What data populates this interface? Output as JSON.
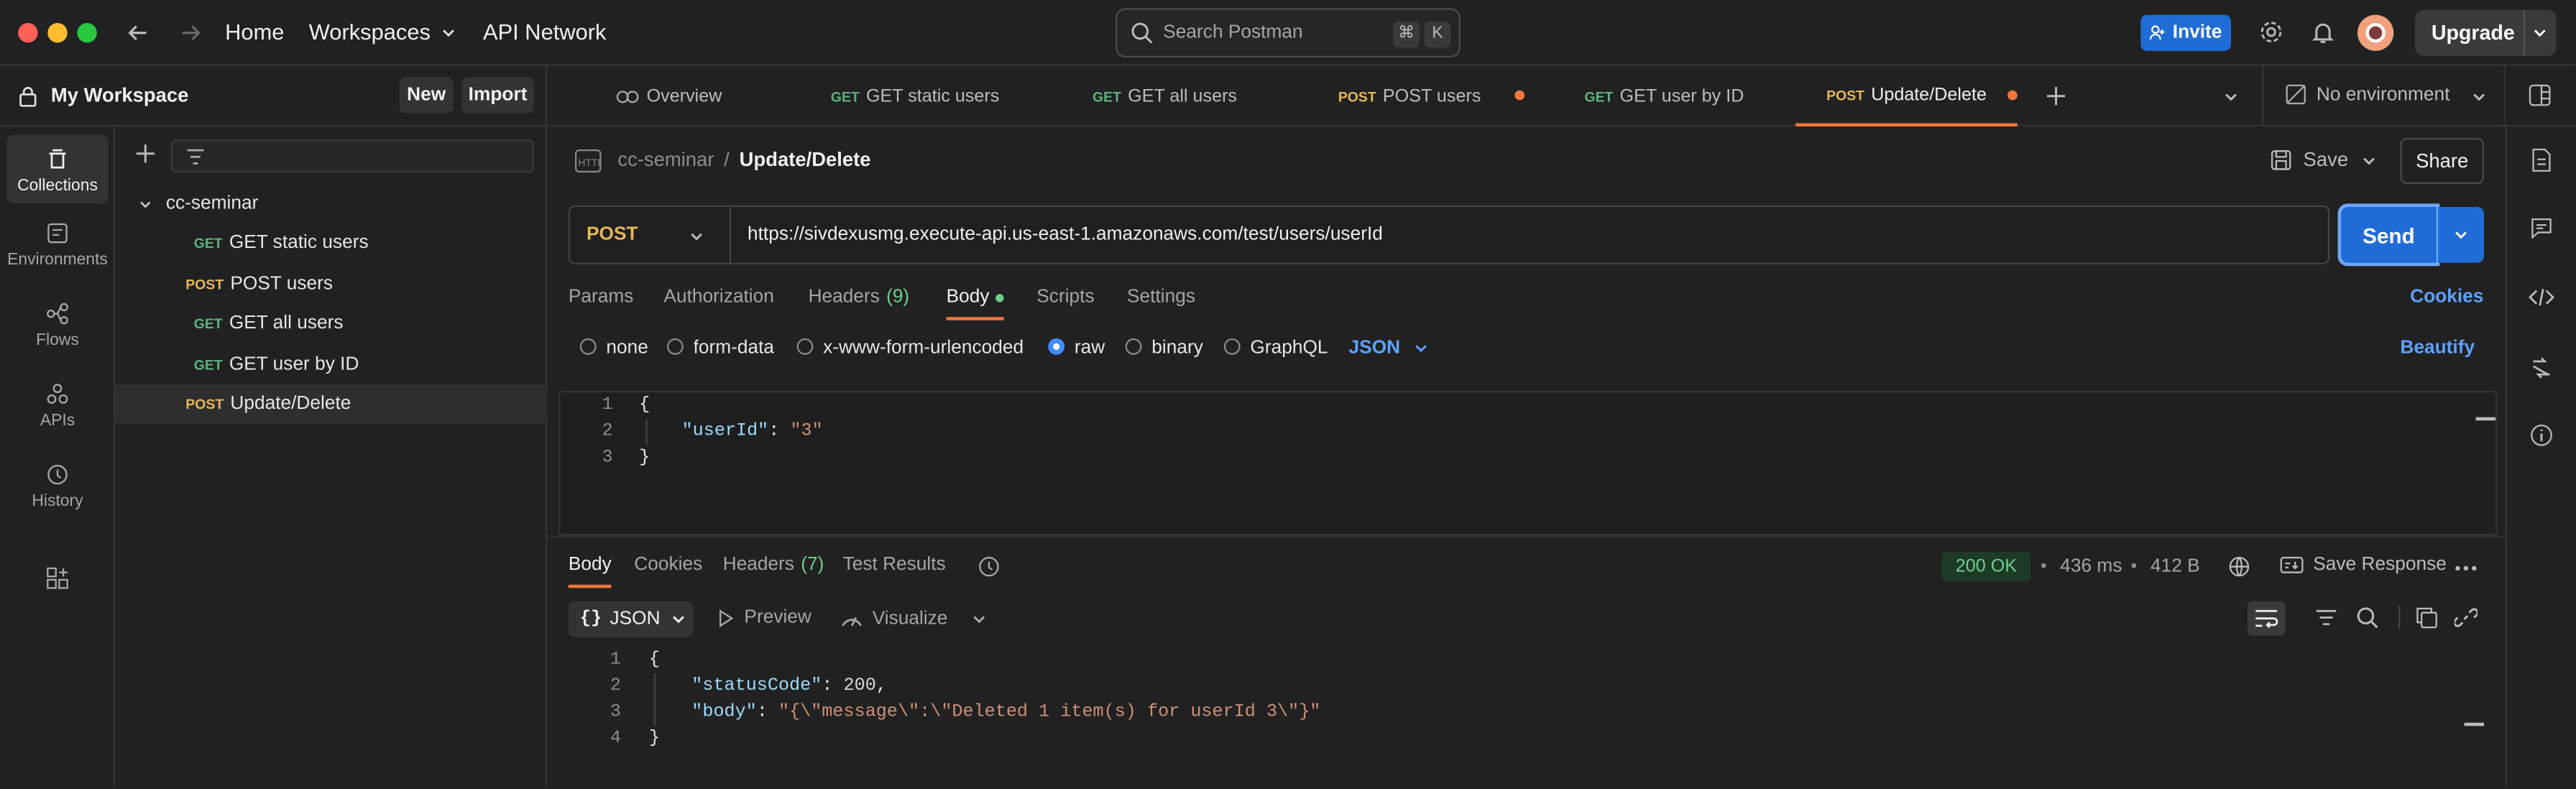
{
  "topbar": {
    "home": "Home",
    "workspaces": "Workspaces",
    "api_network": "API Network",
    "search_placeholder": "Search Postman",
    "kbd1": "⌘",
    "kbd2": "K",
    "invite": "Invite",
    "upgrade": "Upgrade"
  },
  "workspace": {
    "name": "My Workspace",
    "new": "New",
    "import": "Import"
  },
  "rail": [
    {
      "label": "Collections"
    },
    {
      "label": "Environments"
    },
    {
      "label": "Flows"
    },
    {
      "label": "APIs"
    },
    {
      "label": "History"
    }
  ],
  "sidebar": {
    "collection": "cc-seminar",
    "items": [
      {
        "method": "GET",
        "name": "GET static users"
      },
      {
        "method": "POST",
        "name": "POST users"
      },
      {
        "method": "GET",
        "name": "GET all users"
      },
      {
        "method": "GET",
        "name": "GET user by ID"
      },
      {
        "method": "POST",
        "name": "Update/Delete"
      }
    ]
  },
  "tabs": [
    {
      "method": "",
      "name": "Overview"
    },
    {
      "method": "GET",
      "name": "GET static users"
    },
    {
      "method": "GET",
      "name": "GET all users"
    },
    {
      "method": "POST",
      "name": "POST users"
    },
    {
      "method": "GET",
      "name": "GET user by ID"
    },
    {
      "method": "POST",
      "name": "Update/Delete"
    }
  ],
  "environment": "No environment",
  "request": {
    "breadcrumb_parent": "cc-seminar",
    "breadcrumb_sep": "/",
    "breadcrumb_current": "Update/Delete",
    "save": "Save",
    "share": "Share",
    "method": "POST",
    "url": "https://sivdexusmg.execute-api.us-east-1.amazonaws.com/test/users/userId",
    "send": "Send",
    "tabs": {
      "params": "Params",
      "authorization": "Authorization",
      "headers": "Headers",
      "headers_count": "(9)",
      "body": "Body",
      "scripts": "Scripts",
      "settings": "Settings",
      "cookies": "Cookies"
    },
    "body_options": {
      "none": "none",
      "form_data": "form-data",
      "urlencoded": "x-www-form-urlencoded",
      "raw": "raw",
      "binary": "binary",
      "graphql": "GraphQL",
      "format": "JSON",
      "beautify": "Beautify"
    },
    "code": {
      "l1": "{",
      "l2_key": "\"userId\"",
      "l2_colon": ": ",
      "l2_val": "\"3\"",
      "l3": "}"
    }
  },
  "response": {
    "tabs": {
      "body": "Body",
      "cookies": "Cookies",
      "headers": "Headers",
      "headers_count": "(7)",
      "test_results": "Test Results"
    },
    "status": "200 OK",
    "time": "436 ms",
    "size": "412 B",
    "save_response": "Save Response",
    "format": "JSON",
    "format_icon": "{}",
    "preview": "Preview",
    "visualize": "Visualize",
    "code": {
      "l1": "{",
      "l2_key": "\"statusCode\"",
      "l2_colon": ": ",
      "l2_val": "200",
      "l2_comma": ",",
      "l3_key": "\"body\"",
      "l3_colon": ": ",
      "l3_val": "\"{\\\"message\\\":\\\"Deleted 1 item(s) for userId 3\\\"}\"",
      "l4": "}"
    }
  }
}
